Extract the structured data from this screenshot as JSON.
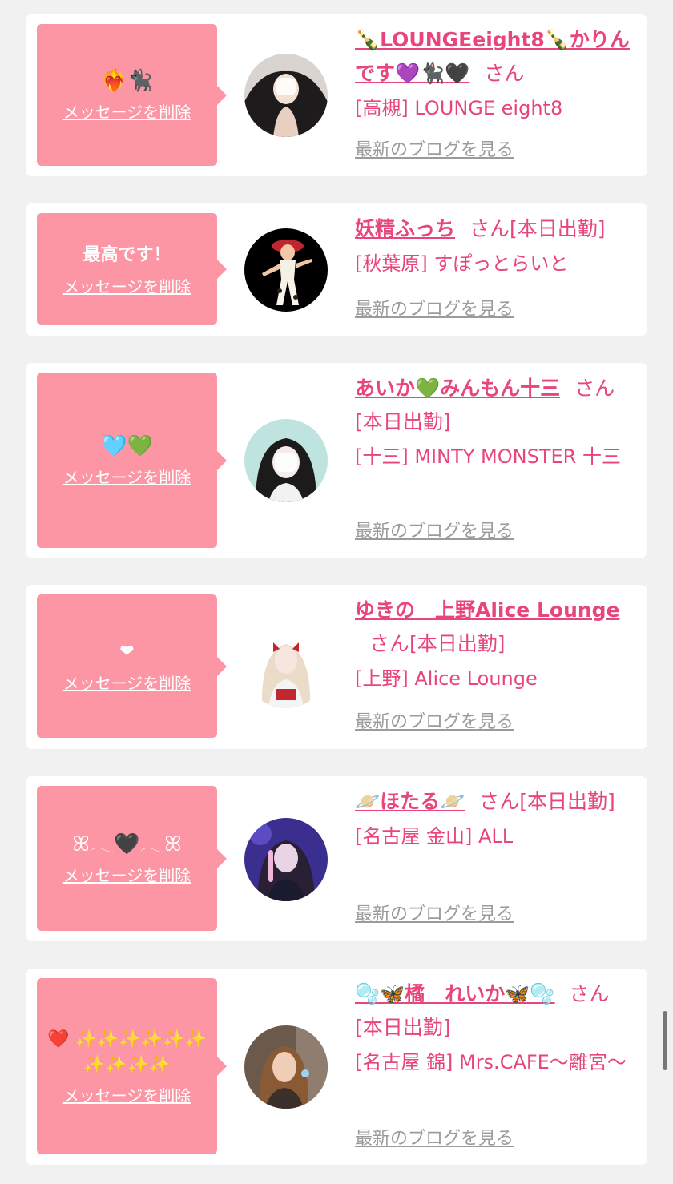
{
  "entries": [
    {
      "message": "❤️‍🔥🐈‍⬛",
      "delete_label": "メッセージを削除",
      "name": "🍾LOUNGEeight8🍾かりんです💜🐈‍⬛🖤",
      "suffix": "さん",
      "status": "",
      "shop": "[高槻] LOUNGE eight8",
      "blog_label": "最新のブログを見る"
    },
    {
      "message": "最高です！",
      "delete_label": "メッセージを削除",
      "name": "妖精ふっち",
      "suffix": "さん",
      "status": "[本日出勤]",
      "shop": "[秋葉原] すぽっとらいと",
      "blog_label": "最新のブログを見る"
    },
    {
      "message": "🩵💚",
      "delete_label": "メッセージを削除",
      "name": "あいか💚みんもん十三",
      "suffix": "さん",
      "status": "[本日出勤]",
      "shop": "[十三] MINTY MONSTER 十三",
      "blog_label": "最新のブログを見る"
    },
    {
      "message": "❤",
      "delete_label": "メッセージを削除",
      "name": "ゆきの　上野Alice Lounge",
      "suffix": "さん",
      "status": "[本日出勤]",
      "shop": "[上野] Alice Lounge",
      "blog_label": "最新のブログを見る"
    },
    {
      "message": "ꕤ𓂃🖤𓂃ꕤ",
      "delete_label": "メッセージを削除",
      "name": "🪐ほたる🪐",
      "suffix": "さん",
      "status": "[本日出勤]",
      "shop": "[名古屋 金山] ALL",
      "blog_label": "最新のブログを見る"
    },
    {
      "message": "❤️ ✨✨✨✨✨✨✨✨✨✨",
      "delete_label": "メッセージを削除",
      "name": "🫧🦋橘　れいか🦋🫧",
      "suffix": "さん",
      "status": "[本日出勤]",
      "shop": "[名古屋 錦] Mrs.CAFE〜離宮〜",
      "blog_label": "最新のブログを見る"
    }
  ],
  "colors": {
    "page_bg": "#f1f1f1",
    "card_bg": "#ffffff",
    "bubble_bg": "#fc95a4",
    "name_color": "#e8457a",
    "blog_link_color": "#9b9b9b"
  }
}
